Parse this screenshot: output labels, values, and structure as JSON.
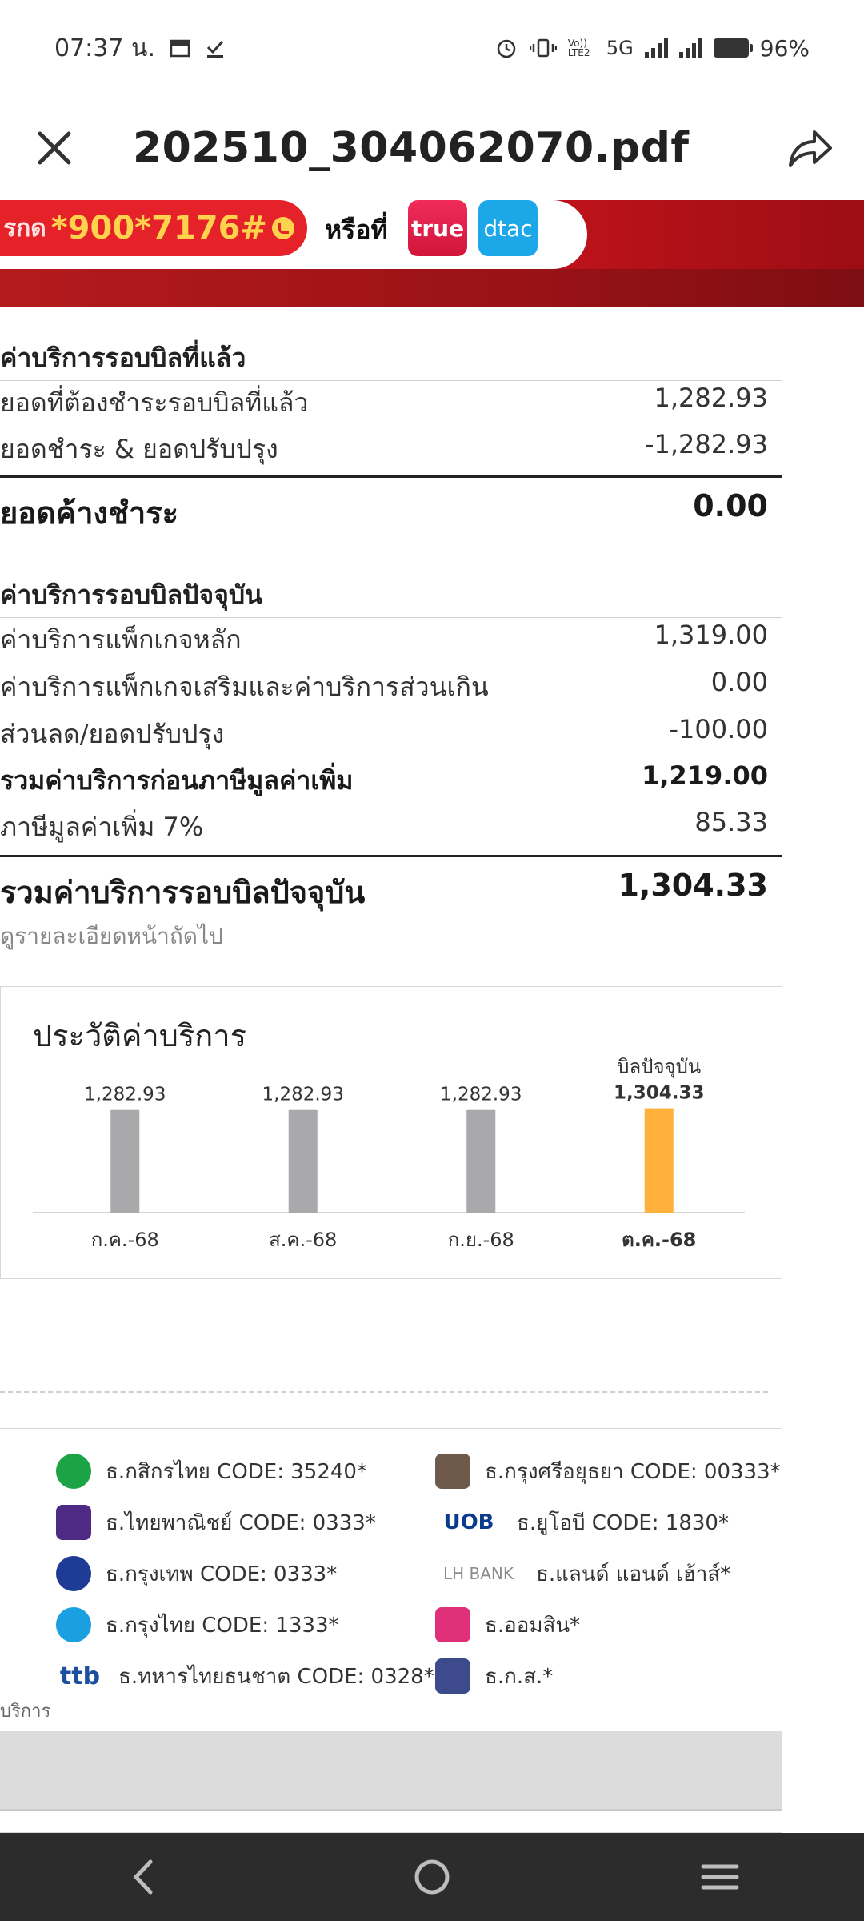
{
  "status_bar": {
    "time": "07:37 น.",
    "network_label": "5G",
    "volte_label": "Vo)) LTE2",
    "battery": "96%"
  },
  "app_bar": {
    "title": "202510_304062070.pdf"
  },
  "banner": {
    "prefix": "รกด",
    "ussd_code": "*900*7176#",
    "or_text": "หรือที่",
    "true_logo": "true",
    "dtac_logo": "dtac"
  },
  "previous_cycle": {
    "title": "ค่าบริการรอบบิลที่แล้ว",
    "rows": [
      {
        "label": "ยอดที่ต้องชำระรอบบิลที่แล้ว",
        "value": "1,282.93"
      },
      {
        "label": "ยอดชำระ & ยอดปรับปรุง",
        "value": "-1,282.93"
      }
    ],
    "outstanding": {
      "label": "ยอดค้างชำระ",
      "value": "0.00"
    }
  },
  "current_cycle": {
    "title": "ค่าบริการรอบบิลปัจจุบัน",
    "rows": [
      {
        "label": "ค่าบริการแพ็กเกจหลัก",
        "value": "1,319.00"
      },
      {
        "label": "ค่าบริการแพ็กเกจเสริมและค่าบริการส่วนเกิน",
        "value": "0.00"
      },
      {
        "label": "ส่วนลด/ยอดปรับปรุง",
        "value": "-100.00"
      },
      {
        "label": "รวมค่าบริการก่อนภาษีมูลค่าเพิ่ม",
        "value": "1,219.00"
      },
      {
        "label": "ภาษีมูลค่าเพิ่ม 7%",
        "value": "85.33"
      }
    ],
    "total": {
      "label": "รวมค่าบริการรอบบิลปัจจุบัน",
      "value": "1,304.33"
    },
    "note": "ดูรายละเอียดหน้าถัดไป"
  },
  "chart_data": {
    "type": "bar",
    "title": "ประวัติค่าบริการ",
    "categories": [
      "ก.ค.-68",
      "ส.ค.-68",
      "ก.ย.-68",
      "ต.ค.-68"
    ],
    "values": [
      1282.93,
      1282.93,
      1282.93,
      1304.33
    ],
    "value_labels": [
      "1,282.93",
      "1,282.93",
      "1,282.93",
      "1,304.33"
    ],
    "current_label": "บิลปัจจุบัน",
    "colors": [
      "#a9a8ab",
      "#a9a8ab",
      "#a9a8ab",
      "#ffb13b"
    ],
    "ylim": [
      0,
      1400
    ],
    "grid": false
  },
  "banks": [
    {
      "name": "ธ.กสิกรไทย CODE: 35240*",
      "icon": "kbank-icon",
      "color": "#1ba345"
    },
    {
      "name": "ธ.กรุงศรีอยุธยา CODE: 00333*",
      "icon": "krungsri-icon",
      "color": "#6e5a4a"
    },
    {
      "name": "ธ.ไทยพาณิชย์ CODE: 0333*",
      "icon": "scb-icon",
      "color": "#4e2a84"
    },
    {
      "name": "ธ.ยูโอบี CODE: 1830*",
      "icon": "uob-icon",
      "color": "#0b3b8c"
    },
    {
      "name": "ธ.กรุงเทพ CODE: 0333*",
      "icon": "bbl-icon",
      "color": "#1e3c96"
    },
    {
      "name": "ธ.แลนด์ แอนด์ เฮ้าส์*",
      "icon": "lhbank-icon",
      "color": "#8c8c8c"
    },
    {
      "name": "ธ.กรุงไทย CODE: 1333*",
      "icon": "ktb-icon",
      "color": "#1a9fe0"
    },
    {
      "name": "ธ.ออมสิน*",
      "icon": "gsb-icon",
      "color": "#e0307a"
    },
    {
      "name": "ธ.ทหารไทยธนชาต CODE: 0328*",
      "icon": "ttb-icon",
      "color": "#1b4fa0"
    },
    {
      "name": "ธ.ก.ส.*",
      "icon": "baac-icon",
      "color": "#3d4a8c"
    }
  ],
  "banks_footer": "บริการ",
  "uob_text": "UOB",
  "lh_text": "LH BANK",
  "ttb_text": "ttb"
}
